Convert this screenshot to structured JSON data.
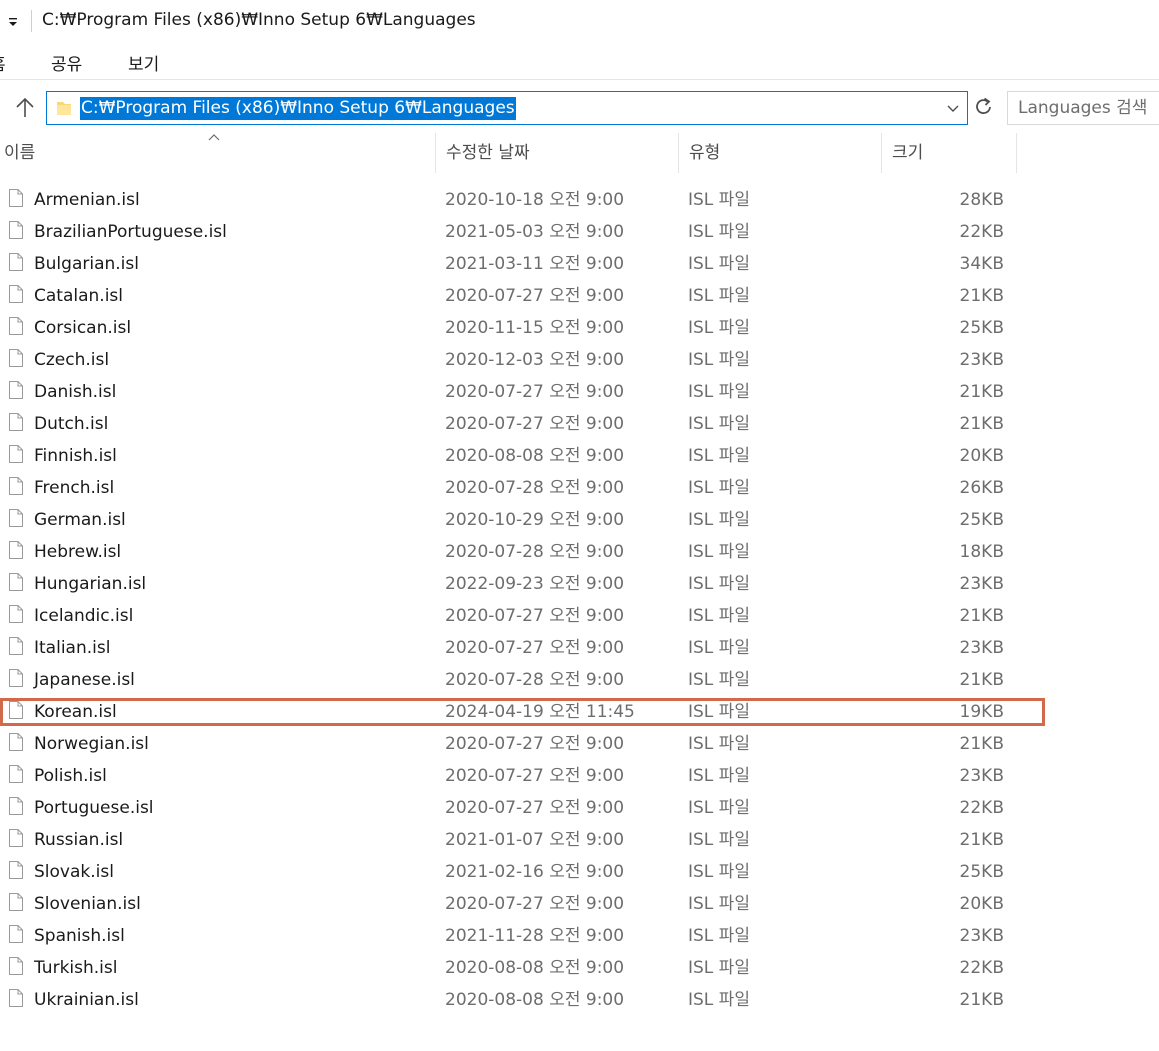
{
  "window": {
    "title": "C:₩Program Files (x86)₩Inno Setup 6₩Languages"
  },
  "ribbon": {
    "tabs": [
      "홈",
      "공유",
      "보기"
    ]
  },
  "address": {
    "path": "C:₩Program Files (x86)₩Inno Setup 6₩Languages"
  },
  "search": {
    "placeholder": "Languages 검색"
  },
  "columns": {
    "name": "이름",
    "date": "수정한 날짜",
    "type": "유형",
    "size": "크기"
  },
  "files": [
    {
      "name": "Armenian.isl",
      "date": "2020-10-18 오전 9:00",
      "type": "ISL 파일",
      "size": "28KB"
    },
    {
      "name": "BrazilianPortuguese.isl",
      "date": "2021-05-03 오전 9:00",
      "type": "ISL 파일",
      "size": "22KB"
    },
    {
      "name": "Bulgarian.isl",
      "date": "2021-03-11 오전 9:00",
      "type": "ISL 파일",
      "size": "34KB"
    },
    {
      "name": "Catalan.isl",
      "date": "2020-07-27 오전 9:00",
      "type": "ISL 파일",
      "size": "21KB"
    },
    {
      "name": "Corsican.isl",
      "date": "2020-11-15 오전 9:00",
      "type": "ISL 파일",
      "size": "25KB"
    },
    {
      "name": "Czech.isl",
      "date": "2020-12-03 오전 9:00",
      "type": "ISL 파일",
      "size": "23KB"
    },
    {
      "name": "Danish.isl",
      "date": "2020-07-27 오전 9:00",
      "type": "ISL 파일",
      "size": "21KB"
    },
    {
      "name": "Dutch.isl",
      "date": "2020-07-27 오전 9:00",
      "type": "ISL 파일",
      "size": "21KB"
    },
    {
      "name": "Finnish.isl",
      "date": "2020-08-08 오전 9:00",
      "type": "ISL 파일",
      "size": "20KB"
    },
    {
      "name": "French.isl",
      "date": "2020-07-28 오전 9:00",
      "type": "ISL 파일",
      "size": "26KB"
    },
    {
      "name": "German.isl",
      "date": "2020-10-29 오전 9:00",
      "type": "ISL 파일",
      "size": "25KB"
    },
    {
      "name": "Hebrew.isl",
      "date": "2020-07-28 오전 9:00",
      "type": "ISL 파일",
      "size": "18KB"
    },
    {
      "name": "Hungarian.isl",
      "date": "2022-09-23 오전 9:00",
      "type": "ISL 파일",
      "size": "23KB"
    },
    {
      "name": "Icelandic.isl",
      "date": "2020-07-27 오전 9:00",
      "type": "ISL 파일",
      "size": "21KB"
    },
    {
      "name": "Italian.isl",
      "date": "2020-07-27 오전 9:00",
      "type": "ISL 파일",
      "size": "23KB"
    },
    {
      "name": "Japanese.isl",
      "date": "2020-07-28 오전 9:00",
      "type": "ISL 파일",
      "size": "21KB"
    },
    {
      "name": "Korean.isl",
      "date": "2024-04-19 오전 11:45",
      "type": "ISL 파일",
      "size": "19KB"
    },
    {
      "name": "Norwegian.isl",
      "date": "2020-07-27 오전 9:00",
      "type": "ISL 파일",
      "size": "21KB"
    },
    {
      "name": "Polish.isl",
      "date": "2020-07-27 오전 9:00",
      "type": "ISL 파일",
      "size": "23KB"
    },
    {
      "name": "Portuguese.isl",
      "date": "2020-07-27 오전 9:00",
      "type": "ISL 파일",
      "size": "22KB"
    },
    {
      "name": "Russian.isl",
      "date": "2021-01-07 오전 9:00",
      "type": "ISL 파일",
      "size": "21KB"
    },
    {
      "name": "Slovak.isl",
      "date": "2021-02-16 오전 9:00",
      "type": "ISL 파일",
      "size": "25KB"
    },
    {
      "name": "Slovenian.isl",
      "date": "2020-07-27 오전 9:00",
      "type": "ISL 파일",
      "size": "20KB"
    },
    {
      "name": "Spanish.isl",
      "date": "2021-11-28 오전 9:00",
      "type": "ISL 파일",
      "size": "23KB"
    },
    {
      "name": "Turkish.isl",
      "date": "2020-08-08 오전 9:00",
      "type": "ISL 파일",
      "size": "22KB"
    },
    {
      "name": "Ukrainian.isl",
      "date": "2020-08-08 오전 9:00",
      "type": "ISL 파일",
      "size": "21KB"
    }
  ],
  "colors": {
    "accent": "#0078d7",
    "highlight_border": "#d16a4a"
  },
  "icons": {
    "up": "arrow-up-icon",
    "refresh": "refresh-icon",
    "folder": "folder-icon",
    "file": "file-icon",
    "dropdown": "chevron-down-icon"
  }
}
